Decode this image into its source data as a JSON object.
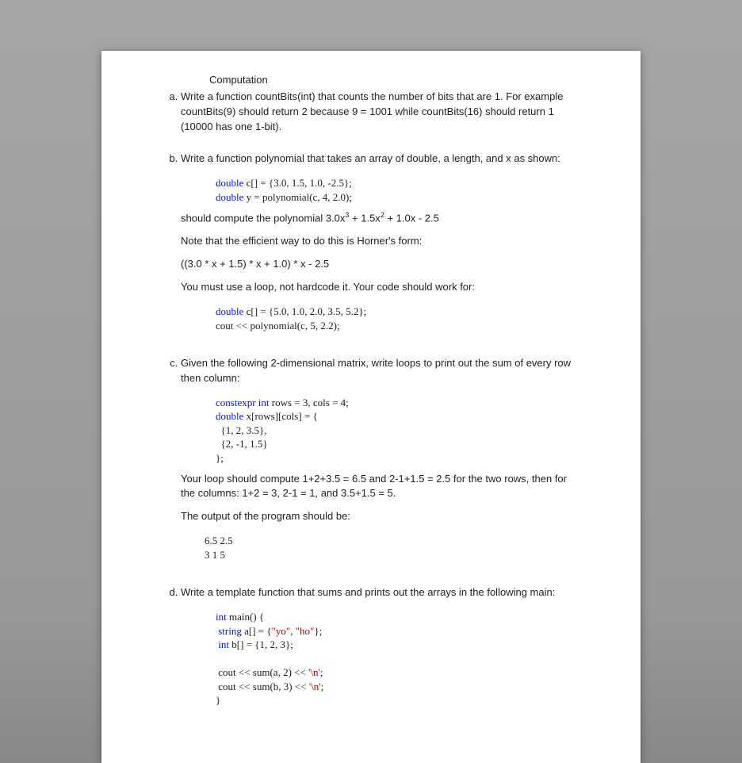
{
  "header": "Computation",
  "items": {
    "a": {
      "p1": "Write a function countBits(int) that counts the number of bits that are 1. For example countBits(9) should return 2 because 9 = 1001 while countBits(16) should return 1 (10000 has one 1-bit)."
    },
    "b": {
      "p1": "Write a function polynomial that takes an array of double, a length, and x as shown:",
      "code1_l1a": "double",
      "code1_l1b": " c[] = {3.0, 1.5, 1.0, -2.5};",
      "code1_l2a": "double",
      "code1_l2b": " y = polynomial(c, 4, 2.0);",
      "p2_prefix": "should compute the polynomial 3.0x",
      "p2_mid1": " + 1.5x",
      "p2_suffix": " + 1.0x - 2.5",
      "sup3": "3",
      "sup2": "2",
      "p3": "Note that the efficient way to do this is Horner's form:",
      "p4": "((3.0 * x + 1.5) * x + 1.0) * x - 2.5",
      "p5": "You must use a loop, not hardcode it. Your code should work for:",
      "code2_l1a": "double",
      "code2_l1b": " c[] = {5.0, 1.0, 2.0, 3.5, 5.2};",
      "code2_l2": "cout << polynomial(c, 5, 2.2);"
    },
    "c": {
      "p1": "Given the following 2-dimensional matrix, write loops to print out the sum of every row then column:",
      "code_l1a": "constexpr int",
      "code_l1b": " rows = 3, cols = 4;",
      "code_l2a": "double",
      "code_l2b": " x[rows][cols] = {",
      "code_l3": "  {1, 2, 3.5},",
      "code_l4": "  {2, -1, 1.5}",
      "code_l5": "};",
      "p2": "Your loop should compute 1+2+3.5 = 6.5 and 2-1+1.5 = 2.5 for the two rows, then for the columns: 1+2 = 3, 2-1 = 1, and 3.5+1.5 = 5.",
      "p3": "The output of the program should be:",
      "out_l1": "6.5 2.5",
      "out_l2": "3 1 5"
    },
    "d": {
      "p1": "Write a template function that sums and prints out the arrays in the following main:",
      "code_l1a": "int",
      "code_l1b": " main() {",
      "code_l2a": " string",
      "code_l2b": " a[] = {",
      "code_l2c": "\"yo\"",
      "code_l2d": ", ",
      "code_l2e": "\"ho\"",
      "code_l2f": "};",
      "code_l3a": " int",
      "code_l3b": " b[] = {1, 2, 3};",
      "code_blank": "",
      "code_l4a": " cout << sum(a, 2) << ",
      "code_l4b": "'\\n'",
      "code_l4c": ";",
      "code_l5a": " cout << sum(b, 3) << ",
      "code_l5b": "'\\n'",
      "code_l5c": ";",
      "code_l6": "}"
    }
  }
}
